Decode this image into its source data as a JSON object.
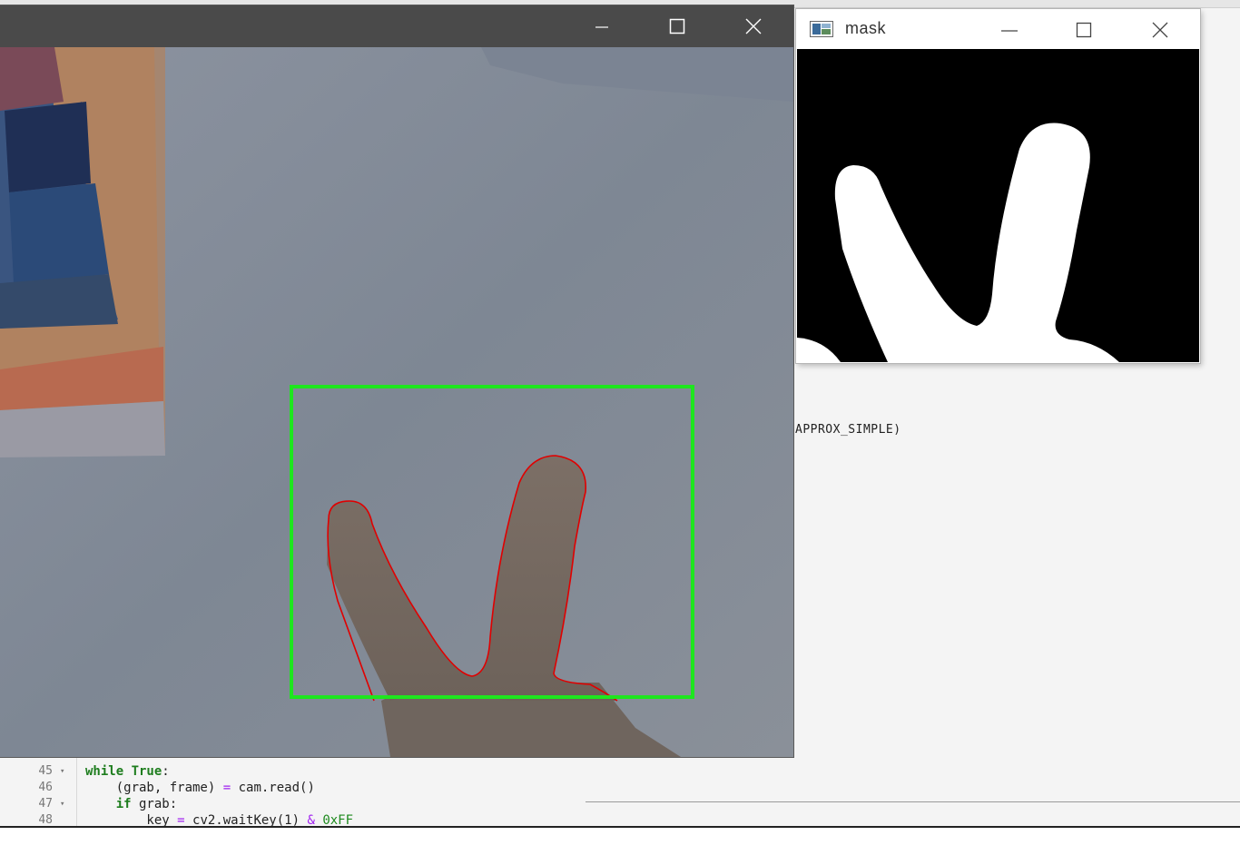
{
  "ide": {
    "snippet": "APPROX_SIMPLE)",
    "code_lines": [
      {
        "number": "45",
        "fold": "▾",
        "segments": [
          {
            "t": "while ",
            "c": "kw"
          },
          {
            "t": "True",
            "c": "kw"
          },
          {
            "t": ":",
            "c": ""
          }
        ]
      },
      {
        "number": "46",
        "fold": "",
        "segments": [
          {
            "t": "    (grab, frame) ",
            "c": ""
          },
          {
            "t": "=",
            "c": "op"
          },
          {
            "t": " cam.read()",
            "c": ""
          }
        ]
      },
      {
        "number": "47",
        "fold": "▾",
        "segments": [
          {
            "t": "    ",
            "c": ""
          },
          {
            "t": "if",
            "c": "kw"
          },
          {
            "t": " grab:",
            "c": ""
          }
        ]
      },
      {
        "number": "48",
        "fold": "",
        "segments": [
          {
            "t": "        key ",
            "c": ""
          },
          {
            "t": "=",
            "c": "op"
          },
          {
            "t": " cv2.waitKey(1) ",
            "c": ""
          },
          {
            "t": "&",
            "c": "op"
          },
          {
            "t": " ",
            "c": ""
          },
          {
            "t": "0xFF",
            "c": "num"
          }
        ]
      }
    ]
  },
  "camera_window": {
    "title": "",
    "controls": {
      "minimize": "minimize-icon",
      "maximize": "maximize-icon",
      "close": "close-icon"
    },
    "colors": {
      "titlebar": "#4a4a4a",
      "roi_box": "#1ee61e",
      "contour": "#e00000"
    }
  },
  "mask_window": {
    "title": "mask",
    "icon": "opencv-window-icon",
    "controls": {
      "minimize": "minimize-icon",
      "maximize": "maximize-icon",
      "close": "close-icon"
    },
    "colors": {
      "background": "#000000",
      "foreground": "#ffffff"
    }
  }
}
